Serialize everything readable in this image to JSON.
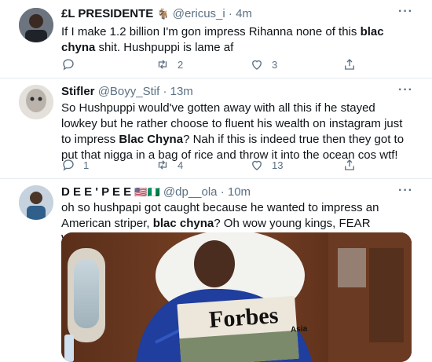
{
  "tweets": [
    {
      "name": "£L PRESIDENTE",
      "name_emoji": "🐐",
      "handle": "@ericus_i",
      "dot": "·",
      "time": "4m",
      "text_1": "If I make 1.2 billion I'm gon impress Rihanna none of this ",
      "text_bold": "blac chyna",
      "text_2": " shit. Hushpuppi is lame af",
      "replies": "",
      "retweets": "2",
      "likes": "3"
    },
    {
      "name": "Stifler",
      "handle": "@Boyy_Stif",
      "dot": "·",
      "time": "13m",
      "text_1": "So Hushpuppi would've gotten away with all this if he stayed lowkey but he rather choose to fluent his wealth on instagram just to impress ",
      "text_bold": "Blac Chyna",
      "text_2": "? Nah if this is indeed true then they got to put that nigga in a bag of rice and throw it into the ocean cos wtf!",
      "replies": "1",
      "retweets": "4",
      "likes": "13"
    },
    {
      "name": "D E E ' P E E",
      "name_emoji": "🇺🇸🇳🇬",
      "handle": "@dp__ola",
      "dot": "·",
      "time": "10m",
      "text_1": "oh so hushpapi got caught because he wanted to impress an American striper, ",
      "text_bold": "blac chyna",
      "text_2": "? Oh wow young kings, FEAR WOMEN!! 👍🏽",
      "magazine_title": "Forbes",
      "magazine_sub": "Asia"
    }
  ],
  "more_glyph": "···",
  "icons": [
    "reply-icon",
    "retweet-icon",
    "like-icon",
    "share-icon",
    "more-icon"
  ]
}
